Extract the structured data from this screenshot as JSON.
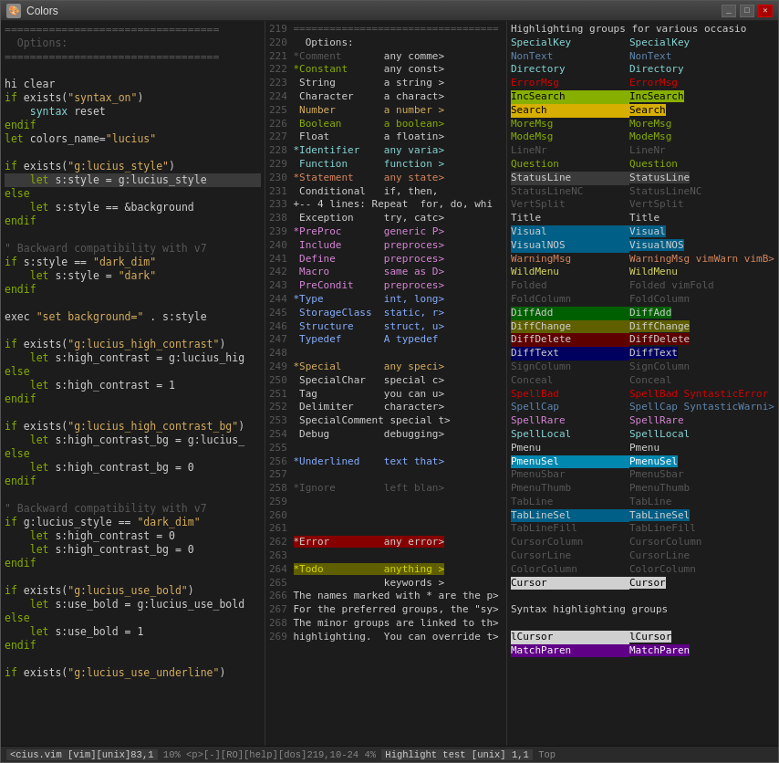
{
  "window": {
    "title": "Colors",
    "titlebar_icon": "🎨"
  },
  "statusbar": {
    "left": "<cius.vim [vim][unix]83,1         10%  <p>[-][RO][help][dos]219,10-24          4%  Highlight test [unix] 1,1       Top"
  },
  "left_code": [
    "==================================",
    "  Options:",
    "==================================",
    "",
    "hi clear",
    "if exists(\"syntax_on\")",
    "    syntax reset",
    "endif",
    "let colors_name=\"lucius\"",
    "",
    "if exists(\"g:lucius_style\")",
    "    let s:style = g:lucius_style",
    "else",
    "    let s:style == &background",
    "endif",
    "",
    "\" Backward compatibility with v7",
    "if s:style == \"dark_dim\"",
    "    let s:style = \"dark\"",
    "endif",
    "",
    "exec \"set background=\" . s:style",
    "",
    "if exists(\"g:lucius_high_contrast\")",
    "    let s:high_contrast = g:lucius_hig",
    "else",
    "    let s:high_contrast = 1",
    "endif",
    "",
    "if exists(\"g:lucius_high_contrast_bg\")",
    "    let s:high_contrast_bg = g:lucius_",
    "else",
    "    let s:high_contrast_bg = 0",
    "endif",
    "",
    "\" Backward compatibility with v7",
    "if g:lucius_style == \"dark_dim\"",
    "    let s:high_contrast = 0",
    "    let s:high_contrast_bg = 0",
    "endif",
    "",
    "if exists(\"g:lucius_use_bold\")",
    "    let s:use_bold = g:lucius_use_bold",
    "else",
    "    let s:use_bold = 1",
    "endif",
    "",
    "if exists(\"g:lucius_use_underline\")"
  ],
  "mid_lines": [
    {
      "num": "219",
      "text": "=================================="
    },
    {
      "num": "220",
      "text": "  Options:"
    },
    {
      "num": "221",
      "text": "*Comment       any comme>"
    },
    {
      "num": "222",
      "text": "*Constant      any const>"
    },
    {
      "num": "223",
      "text": " String        a string >"
    },
    {
      "num": "224",
      "text": " Character     a charact>"
    },
    {
      "num": "225",
      "text": " Number        a number >"
    },
    {
      "num": "226",
      "text": " Boolean       a boolean>"
    },
    {
      "num": "227",
      "text": " Float         a floatin>"
    },
    {
      "num": "228",
      "text": "*Identifier    any varia>"
    },
    {
      "num": "229",
      "text": " Function      function >"
    },
    {
      "num": "230",
      "text": "*Statement     any state>"
    },
    {
      "num": "231",
      "text": " Conditional   if, then,"
    },
    {
      "num": "233",
      "text": "+-- 4 lines: Repeat  for, do, whi"
    },
    {
      "num": "238",
      "text": " Exception     try, catc>"
    },
    {
      "num": "239",
      "text": "*PreProc       generic P>"
    },
    {
      "num": "240",
      "text": " Include       preproces>"
    },
    {
      "num": "241",
      "text": " Define        preproces>"
    },
    {
      "num": "242",
      "text": " Macro         same as D>"
    },
    {
      "num": "243",
      "text": " PreCondit     preproces>"
    },
    {
      "num": "244",
      "text": "*Type          int, long>"
    },
    {
      "num": "245",
      "text": " StorageClass  static, r>"
    },
    {
      "num": "246",
      "text": " Structure     struct, u>"
    },
    {
      "num": "247",
      "text": " Typedef       A typedef"
    },
    {
      "num": "248",
      "text": ""
    },
    {
      "num": "249",
      "text": "*Special       any speci>"
    },
    {
      "num": "250",
      "text": " SpecialChar   special c>"
    },
    {
      "num": "251",
      "text": " Tag           you can u>"
    },
    {
      "num": "252",
      "text": " Delimiter     character>"
    },
    {
      "num": "253",
      "text": " SpecialComment special t>"
    },
    {
      "num": "254",
      "text": " Debug         debugging>"
    },
    {
      "num": "255",
      "text": ""
    },
    {
      "num": "256",
      "text": "*Underlined    text that>"
    },
    {
      "num": "257",
      "text": ""
    },
    {
      "num": "258",
      "text": "*Ignore        left blan>"
    },
    {
      "num": "259",
      "text": ""
    },
    {
      "num": "260",
      "text": "                        "
    },
    {
      "num": "261",
      "text": "                        "
    },
    {
      "num": "262",
      "text": "*Error         any error>",
      "error": true
    },
    {
      "num": "263",
      "text": ""
    },
    {
      "num": "264",
      "text": "*Todo          anything >",
      "todo": true
    },
    {
      "num": "265",
      "text": "               keywords >"
    },
    {
      "num": "266",
      "text": "The names marked with * are the p>"
    },
    {
      "num": "267",
      "text": "For the preferred groups, the \"sy>"
    },
    {
      "num": "268",
      "text": "The minor groups are linked to th>"
    },
    {
      "num": "269",
      "text": "highlighting.  You can override t>"
    }
  ],
  "right_items": [
    {
      "label": "Highlighting groups for various occasio"
    },
    {
      "col1": "SpecialKey",
      "col2": "SpecialKey",
      "c1": "cyan",
      "c2": "cyan"
    },
    {
      "col1": "NonText",
      "col2": "NonText",
      "c1": "blue",
      "c2": "blue"
    },
    {
      "col1": "Directory",
      "col2": "Directory",
      "c1": "cyan",
      "c2": "cyan"
    },
    {
      "col1": "ErrorMsg",
      "col2": "ErrorMsg",
      "c1": "red",
      "c2": "red"
    },
    {
      "col1": "IncSearch",
      "col2": "IncSearch",
      "c1": "incsearch",
      "c2": "incsearch"
    },
    {
      "col1": "Search",
      "col2": "Search",
      "c1": "search",
      "c2": "search"
    },
    {
      "col1": "MoreMsg",
      "col2": "MoreMsg",
      "c1": "green",
      "c2": "green"
    },
    {
      "col1": "ModeMsg",
      "col2": "ModeMsg",
      "c1": "green",
      "c2": "green"
    },
    {
      "col1": "LineNr",
      "col2": "LineNr",
      "c1": "gray",
      "c2": "gray"
    },
    {
      "col1": "Question",
      "col2": "Question",
      "c1": "green",
      "c2": "green"
    },
    {
      "col1": "StatusLine",
      "col2": "StatusLine",
      "c1": "statusline",
      "c2": "statusline"
    },
    {
      "col1": "StatusLineNC",
      "col2": "StatusLineNC",
      "c1": "gray",
      "c2": "gray"
    },
    {
      "col1": "VertSplit",
      "col2": "VertSplit",
      "c1": "gray",
      "c2": "gray"
    },
    {
      "col1": "Title",
      "col2": "Title",
      "c1": "white",
      "c2": "white"
    },
    {
      "col1": "Visual",
      "col2": "Visual",
      "c1": "visual",
      "c2": "visual"
    },
    {
      "col1": "VisualNOS",
      "col2": "VisualNOS",
      "c1": "visual",
      "c2": "visual"
    },
    {
      "col1": "WarningMsg",
      "col2": "WarningMsg vimWarn vimB>",
      "c1": "orange",
      "c2": "orange"
    },
    {
      "col1": "WildMenu",
      "col2": "WildMenu",
      "c1": "yellow",
      "c2": "yellow"
    },
    {
      "col1": "Folded",
      "col2": "Folded vimFold",
      "c1": "gray",
      "c2": "gray"
    },
    {
      "col1": "FoldColumn",
      "col2": "FoldColumn",
      "c1": "gray",
      "c2": "gray"
    },
    {
      "col1": "DiffAdd",
      "col2": "DiffAdd",
      "c1": "diffadd",
      "c2": "diffadd"
    },
    {
      "col1": "DiffChange",
      "col2": "DiffChange",
      "c1": "diffchange",
      "c2": "diffchange"
    },
    {
      "col1": "DiffDelete",
      "col2": "DiffDelete",
      "c1": "diffdelete",
      "c2": "diffdelete"
    },
    {
      "col1": "DiffText",
      "col2": "DiffText",
      "c1": "difftext",
      "c2": "difftext"
    },
    {
      "col1": "SignColumn",
      "col2": "SignColumn",
      "c1": "gray",
      "c2": "gray"
    },
    {
      "col1": "Conceal",
      "col2": "Conceal",
      "c1": "gray",
      "c2": "gray"
    },
    {
      "col1": "SpellBad",
      "col2": "SpellBad SyntasticError",
      "c1": "red",
      "c2": "red"
    },
    {
      "col1": "SpellCap",
      "col2": "SpellCap SyntasticWarni>",
      "c1": "blue",
      "c2": "blue"
    },
    {
      "col1": "SpellRare",
      "col2": "SpellRare",
      "c1": "magenta",
      "c2": "magenta"
    },
    {
      "col1": "SpellLocal",
      "col2": "SpellLocal",
      "c1": "cyan",
      "c2": "cyan"
    },
    {
      "col1": "Pmenu",
      "col2": "Pmenu",
      "c1": "gray",
      "c2": "gray"
    },
    {
      "col1": "PmenuSel",
      "col2": "PmenuSel",
      "c1": "pmenusel",
      "c2": "pmenusel"
    },
    {
      "col1": "PmenuSbar",
      "col2": "PmenuSbar",
      "c1": "gray",
      "c2": "gray"
    },
    {
      "col1": "PmenuThumb",
      "col2": "PmenuThumb",
      "c1": "gray",
      "c2": "gray"
    },
    {
      "col1": "TabLine",
      "col2": "TabLine",
      "c1": "gray",
      "c2": "gray"
    },
    {
      "col1": "TabLineSel",
      "col2": "TabLineSel",
      "c1": "tablinesel",
      "c2": "tablinesel"
    },
    {
      "col1": "TabLineFill",
      "col2": "TabLineFill",
      "c1": "gray",
      "c2": "gray"
    },
    {
      "col1": "CursorColumn",
      "col2": "CursorColumn",
      "c1": "gray",
      "c2": "gray"
    },
    {
      "col1": "CursorLine",
      "col2": "CursorLine",
      "c1": "gray",
      "c2": "gray"
    },
    {
      "col1": "ColorColumn",
      "col2": "ColorColumn",
      "c1": "gray",
      "c2": "gray"
    },
    {
      "col1": "Cursor",
      "col2": "Cursor",
      "c1": "cursor",
      "c2": "cursor"
    },
    {
      "col1": ""
    },
    {
      "label": "Syntax highlighting groups"
    },
    {
      "col1": ""
    },
    {
      "col1": "lCursor",
      "col2": "lCursor",
      "c1": "cursor",
      "c2": "cursor"
    },
    {
      "col1": "MatchParen",
      "col2": "MatchParen",
      "c1": "matchparen",
      "c2": "matchparen"
    }
  ]
}
